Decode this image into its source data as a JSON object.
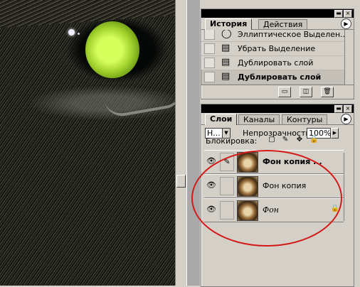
{
  "history_panel": {
    "tabs": [
      "История",
      "Действия"
    ],
    "items": [
      {
        "label": "Эллиптическое Выделен...",
        "icon": "ellipse-select-icon"
      },
      {
        "label": "Убрать Выделение",
        "icon": "history-state-icon"
      },
      {
        "label": "Дублировать слой",
        "icon": "history-state-icon"
      },
      {
        "label": "Дублировать слой",
        "icon": "history-state-icon",
        "active": true
      }
    ]
  },
  "layers_panel": {
    "tabs": [
      "Слои",
      "Каналы",
      "Контуры"
    ],
    "blend_mode": "Н...",
    "opacity_label": "Непрозрачность:",
    "opacity_value": "100%",
    "lock_label": "Блокировка:",
    "layers": [
      {
        "name": "Фон копия ...",
        "selected": true,
        "brush": "✎"
      },
      {
        "name": "Фон копия",
        "selected": false
      },
      {
        "name": "Фон",
        "selected": false,
        "locked": true
      }
    ]
  },
  "colors": {
    "annotation": "#d41818",
    "panel_bg": "#d4d0c8"
  }
}
